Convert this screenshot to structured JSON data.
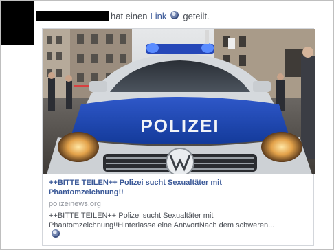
{
  "header": {
    "author_redacted": true,
    "action_prefix": "hat einen",
    "link_word": "Link",
    "action_suffix": "geteilt.",
    "globe_icon": "globe-icon"
  },
  "card": {
    "image_icon": "police-car-photo",
    "image_text": "POLIZEI",
    "title_line1": "++BITTE TEILEN++ Polizei sucht Sexualtäter mit",
    "title_line2": "Phantomzeichnung!!",
    "domain": "polizeinews.org",
    "desc_line1": "++BITTE TEILEN++ Polizei sucht Sexualtäter mit",
    "desc_line2": "Phantomzeichnung!!Hinterlasse eine AntwortNach dem schweren...",
    "globe_icon": "globe-icon"
  },
  "colors": {
    "link": "#3b5998",
    "text": "#4b4f56",
    "muted": "#90949c",
    "police_blue": "#1a3e9a"
  }
}
